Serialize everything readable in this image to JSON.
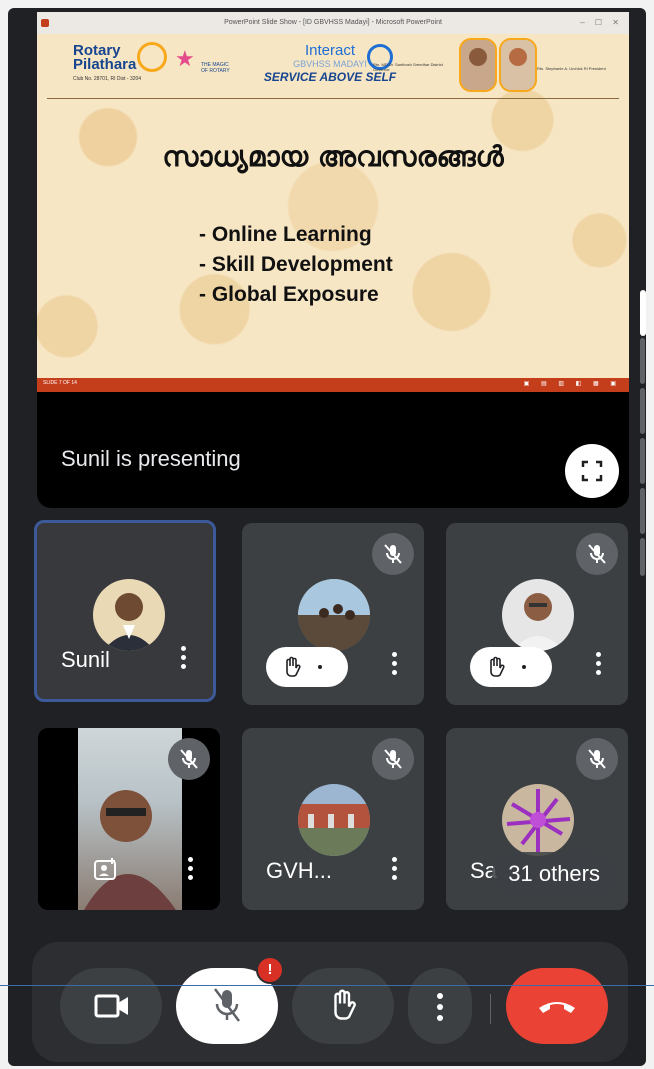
{
  "window": {
    "title": "PowerPoint Slide Show - [ID GBVHSS Madayi] - Microsoft PowerPoint",
    "controls": "– ☐ ✕"
  },
  "slide": {
    "rotary": {
      "line1": "Rotary",
      "line2": "Pilathara",
      "club": "Club No. 28701, RI Dist - 3204"
    },
    "magic": "THE MAGIC OF ROTARY",
    "interact": {
      "line1": "Interact",
      "line2": "GBVHSS MADAYI",
      "line3": "SERVICE ABOVE SELF"
    },
    "dg_name": "Rtn. MD Dr. Santhosh Sreedhar District Governor",
    "rip_name": "Rtn. Stephanie A. Urchick RI President",
    "title": "സാധ്യമായ അവസരങ്ങൾ",
    "bullets": [
      "- Online Learning",
      "- Skill Development",
      "- Global Exposure"
    ],
    "slide_counter": "SLIDE 7 OF 14"
  },
  "presenting": {
    "label": "Sunil is presenting"
  },
  "participants": [
    {
      "name": "Sunil",
      "muted": false,
      "hand_raised": false,
      "active_speaker": true
    },
    {
      "name": "",
      "muted": true,
      "hand_raised": true
    },
    {
      "name": "",
      "muted": true,
      "hand_raised": true
    },
    {
      "name": "",
      "muted": true,
      "hand_raised": false,
      "camera_on": true
    },
    {
      "name": "GVH...",
      "muted": true,
      "hand_raised": false
    },
    {
      "name": "Sa",
      "muted": true,
      "hand_raised": false
    }
  ],
  "others": {
    "label": "31 others"
  },
  "hand_pill_text": ".",
  "controls": {
    "mic_badge": "!",
    "colors": {
      "end_call": "#ea4335",
      "accent": "#3c5a99"
    }
  }
}
